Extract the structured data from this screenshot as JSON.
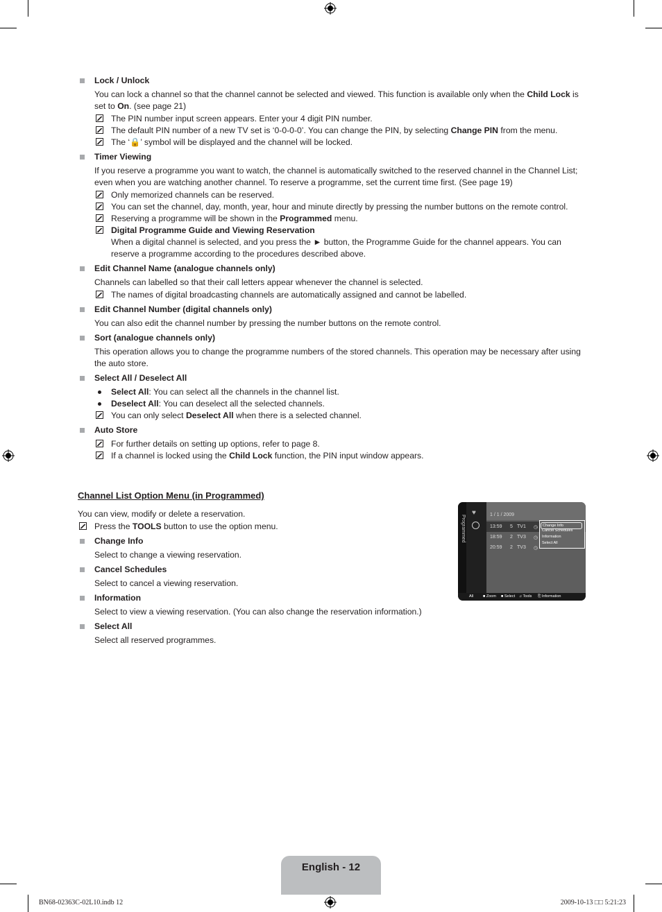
{
  "sections": [
    {
      "title": "Lock / Unlock",
      "paras": [
        [
          "You can lock a channel so that the channel cannot be selected and viewed. This function is available only when the ",
          {
            "b": "Child Lock"
          },
          " is set to ",
          {
            "b": "On"
          },
          ". (see page 21)"
        ]
      ],
      "notes": [
        [
          "The PIN number input screen appears. Enter your 4 digit PIN number."
        ],
        [
          "The default PIN number of a new TV set is ‘0-0-0-0’. You can change the PIN, by selecting ",
          {
            "b": "Change PIN"
          },
          " from the menu."
        ],
        [
          "The ‘🔒’ symbol will be displayed and the channel will be locked."
        ]
      ]
    },
    {
      "title": "Timer Viewing",
      "paras": [
        [
          "If you reserve a programme you want to watch, the channel is automatically switched to the reserved channel in the Channel List; even when you are watching another channel. To reserve a programme, set the current time first. (See page 19)"
        ]
      ],
      "notes": [
        [
          "Only memorized channels can be reserved."
        ],
        [
          "You can set the channel, day, month, year, hour and minute directly by pressing the number buttons on the remote control."
        ],
        [
          "Reserving a programme will be shown in the ",
          {
            "b": "Programmed"
          },
          " menu."
        ],
        [
          {
            "b": "Digital Programme Guide and Viewing Reservation"
          }
        ]
      ],
      "subpara": "When a digital channel is selected, and you press the ► button, the Programme Guide for the channel appears. You can reserve a programme according to the procedures described above."
    },
    {
      "title": "Edit Channel Name (analogue channels only)",
      "paras": [
        [
          "Channels can labelled so that their call letters appear whenever the channel is selected."
        ]
      ],
      "notes": [
        [
          "The names of digital broadcasting channels are automatically assigned and cannot be labelled."
        ]
      ]
    },
    {
      "title": "Edit Channel Number (digital channels only)",
      "paras": [
        [
          "You can also edit the channel number by pressing the number buttons on the remote control."
        ]
      ],
      "notes": []
    },
    {
      "title": "Sort (analogue channels only)",
      "paras": [
        [
          "This operation allows you to change the programme numbers of the stored channels. This operation may be necessary after using the auto store."
        ]
      ],
      "notes": []
    },
    {
      "title": "Select All / Deselect All",
      "paras": [],
      "bullets": [
        [
          {
            "b": "Select All"
          },
          ": You can select all the channels in the channel list."
        ],
        [
          {
            "b": "Deselect All"
          },
          ": You can deselect all the selected channels."
        ]
      ],
      "notes": [
        [
          "You can only select ",
          {
            "b": "Deselect All"
          },
          " when there is a selected channel."
        ]
      ]
    },
    {
      "title": "Auto Store",
      "paras": [],
      "notes": [
        [
          "For further details on setting up options, refer to page 8."
        ],
        [
          "If a channel is locked using the ",
          {
            "b": "Child Lock"
          },
          " function, the PIN input window appears."
        ]
      ]
    }
  ],
  "option_menu": {
    "heading": "Channel List Option Menu (in Programmed)",
    "intro": "You can view, modify or delete a reservation.",
    "note": [
      "Press the ",
      {
        "b": "TOOLS"
      },
      " button to use the option menu."
    ],
    "items": [
      {
        "title": "Change Info",
        "desc": "Select to change a viewing reservation."
      },
      {
        "title": "Cancel Schedules",
        "desc": "Select to cancel a viewing reservation."
      },
      {
        "title": "Information",
        "desc": "Select to view a viewing reservation. (You can also change the reservation information.)"
      },
      {
        "title": "Select All",
        "desc": "Select all reserved programmes."
      }
    ]
  },
  "tv_screen": {
    "side_label": "Programmed",
    "date": "1 / 1 / 2009",
    "rows": [
      {
        "time": "13:59",
        "num": "5",
        "ch": "TV1"
      },
      {
        "time": "18:59",
        "num": "2",
        "ch": "TV3"
      },
      {
        "time": "20:59",
        "num": "2",
        "ch": "TV3"
      }
    ],
    "menu": [
      "Change Info",
      "Cancel Schedules",
      "Information",
      "Select All"
    ],
    "footer": {
      "all": "All",
      "zoom": "■ Zoom",
      "select": "■ Select",
      "tools": "♫ Tools",
      "info": "⎘ Information"
    }
  },
  "page_label": "English - 12",
  "footer": {
    "file": "BN68-02363C-02L10.indb   12",
    "stamp": "2009-10-13   □□ 5:21:23"
  }
}
